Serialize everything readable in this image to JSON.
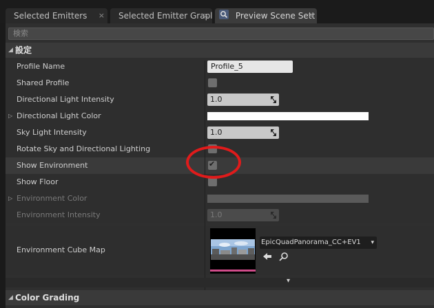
{
  "tabs": [
    {
      "label": "Selected Emitters",
      "close": "×"
    },
    {
      "label": "Selected Emitter Grapl",
      "close": "×"
    },
    {
      "label": "Preview Scene Sett",
      "close": "×"
    }
  ],
  "search": {
    "placeholder": "検索"
  },
  "category_settings": {
    "label": "設定"
  },
  "properties": {
    "profile_name": {
      "label": "Profile Name",
      "value": "Profile_5"
    },
    "shared_profile": {
      "label": "Shared Profile",
      "checked": false
    },
    "dir_light_intensity": {
      "label": "Directional Light Intensity",
      "value": "1.0"
    },
    "dir_light_color": {
      "label": "Directional Light Color",
      "color": "#ffffff"
    },
    "sky_light_intensity": {
      "label": "Sky Light Intensity",
      "value": "1.0"
    },
    "rotate_sky": {
      "label": "Rotate Sky and Directional Lighting",
      "checked": false
    },
    "show_environment": {
      "label": "Show Environment",
      "checked": true,
      "check_glyph": "✔"
    },
    "show_floor": {
      "label": "Show Floor",
      "checked": false
    },
    "environment_color": {
      "label": "Environment Color"
    },
    "environment_intensity": {
      "label": "Environment Intensity",
      "value": "1.0"
    },
    "environment_cube_map": {
      "label": "Environment Cube Map",
      "asset": "EpicQuadPanorama_CC+EV1",
      "dropdown_glyph": "▾"
    }
  },
  "category_color_grading": {
    "label": "Color Grading"
  },
  "glyphs": {
    "collapse_arrow": "◢",
    "expand_arrow": "▷",
    "expand_down": "▾"
  },
  "colors": {
    "annotation_circle": "#e01b1b",
    "thumbnail_bar": "#d04c8a"
  }
}
